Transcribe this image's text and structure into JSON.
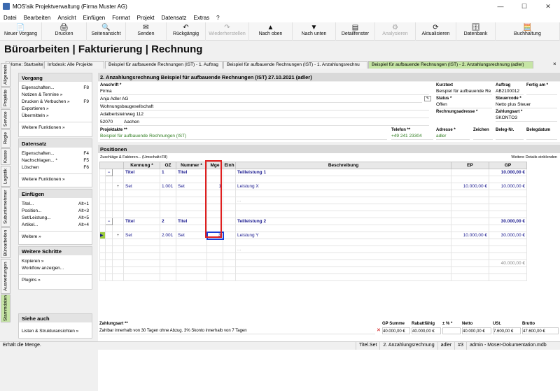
{
  "window": {
    "title": "MOS'aik Projektverwaltung (Firma Muster AG)"
  },
  "menu": [
    "Datei",
    "Bearbeiten",
    "Ansicht",
    "Einfügen",
    "Format",
    "Projekt",
    "Datensatz",
    "Extras",
    "?"
  ],
  "toolbar": [
    {
      "label": "Neuer Vorgang",
      "icon": "📄",
      "w": 60,
      "dis": false
    },
    {
      "label": "Drucken",
      "icon": "🖨",
      "w": 64,
      "dis": false
    },
    {
      "label": "Seitenansicht",
      "icon": "🔍",
      "w": 56,
      "dis": false
    },
    {
      "label": "Senden",
      "icon": "✉",
      "w": 58,
      "dis": false
    },
    {
      "label": "Rückgängig",
      "icon": "↶",
      "w": 56,
      "dis": false
    },
    {
      "label": "Wiederherstellen",
      "icon": "↷",
      "w": 62,
      "dis": true
    },
    {
      "label": "Nach oben",
      "icon": "▲",
      "w": 62,
      "dis": false
    },
    {
      "label": "Nach unten",
      "icon": "▼",
      "w": 62,
      "dis": false
    },
    {
      "label": "Detailfenster",
      "icon": "▤",
      "w": 56,
      "dis": false
    },
    {
      "label": "Analysieren",
      "icon": "⚙",
      "w": 58,
      "dis": true
    },
    {
      "label": "Aktualisieren",
      "icon": "⟳",
      "w": 58,
      "dis": false
    },
    {
      "label": "Datenbank",
      "icon": "🗄",
      "w": 56,
      "dis": false
    },
    {
      "label": "Buchhaltung",
      "icon": "🧮",
      "w": 92,
      "dis": false
    }
  ],
  "page_title": "Büroarbeiten | Fakturierung | Rechnung",
  "tabs": [
    {
      "label": "Home: Startseite",
      "w": 54,
      "active": false
    },
    {
      "label": "Infodesk: Alle Projekte",
      "w": 86,
      "active": false
    },
    {
      "label": "Beispiel für aufbauende Rechnungen (IST) - 1. Auftrag",
      "w": 168,
      "active": false
    },
    {
      "label": "Beispiel für aufbauende Rechnungen (IST) - 1. Anzahlungsrechnu",
      "w": 206,
      "active": false
    },
    {
      "label": "Beispiel für aufbauende Rechnungen (IST) - 2. Anzahlungsrechnung (adler)",
      "w": 236,
      "active": true
    }
  ],
  "tab_close": "×",
  "vertical_tabs": [
    {
      "label": "Allgemein",
      "h": 34,
      "active": false
    },
    {
      "label": "Projekte",
      "h": 30,
      "active": false
    },
    {
      "label": "Service",
      "h": 28,
      "active": false
    },
    {
      "label": "Regie",
      "h": 26,
      "active": false
    },
    {
      "label": "Kasse",
      "h": 24,
      "active": false
    },
    {
      "label": "Logistik",
      "h": 30,
      "active": false
    },
    {
      "label": "Subunternehmer",
      "h": 56,
      "active": false
    },
    {
      "label": "Büroarbeiten",
      "h": 44,
      "active": false
    },
    {
      "label": "Auswertungen",
      "h": 50,
      "active": false
    },
    {
      "label": "Stammdaten",
      "h": 40,
      "active": true
    }
  ],
  "left_panel": {
    "vorgang": {
      "title": "Vorgang",
      "items": [
        {
          "label": "Eigenschaften...",
          "key": "F8"
        },
        {
          "label": "Notizen & Termine »",
          "key": ""
        },
        {
          "label": "Drucken & Verbuchen »",
          "key": "F9"
        },
        {
          "label": "Exportieren »",
          "key": ""
        },
        {
          "label": "Übermitteln »",
          "key": ""
        }
      ],
      "more": "Weitere Funktionen »"
    },
    "datensatz": {
      "title": "Datensatz",
      "items": [
        {
          "label": "Eigenschaften...",
          "key": "F4"
        },
        {
          "label": "Nachschlagen... *",
          "key": "F5"
        },
        {
          "label": "Löschen",
          "key": "F6"
        }
      ],
      "more": "Weitere Funktionen »"
    },
    "einfuegen": {
      "title": "Einfügen",
      "items": [
        {
          "label": "Titel...",
          "key": "Alt+1"
        },
        {
          "label": "Position...",
          "key": "Alt+3"
        },
        {
          "label": "Set/Leistung...",
          "key": "Alt+5"
        },
        {
          "label": "Artikel...",
          "key": "Alt+4"
        }
      ],
      "more": "Weitere »"
    },
    "schritte": {
      "title": "Weitere Schritte",
      "items": [
        {
          "label": "Kopieren »",
          "key": ""
        },
        {
          "label": "Workflow anzeigen...",
          "key": ""
        }
      ],
      "more": "Plugins »"
    },
    "siehe": {
      "title": "Siehe auch",
      "more": "Listen & Strukturansichten »"
    }
  },
  "doc": {
    "header": "2. Anzahlungsrechnung Beispiel für aufbauende Rechnungen (IST) 27.10.2021 (adler)",
    "anschrift_label": "Anschrift *",
    "anschrift": [
      "Firma",
      "Anja Adler AG",
      "Wohnungsbaugesellschaft",
      "Adalbertsteinweg 112"
    ],
    "plz": "52070",
    "ort": "Aachen",
    "kurztext_label": "Kurztext",
    "kurztext": "Beispiel für aufbauende Re",
    "auftrag_label": "Auftrag",
    "auftrag": "AB2100012",
    "fertig_label": "Fertig am *",
    "fertig": "",
    "status_label": "Status *",
    "status": "Offen",
    "steuercode_label": "Steuercode *",
    "steuercode": "Netto plus Steuer",
    "rechnungsadresse_label": "Rechnungsadresse *",
    "zahlungsart_label": "Zahlungsart *",
    "zahlungsart": "SKONTO3",
    "projektakte_label": "Projektakte **",
    "projektakte": "Beispiel für aufbauende Rechnungen (IST)",
    "telefon_label": "Telefon **",
    "telefon": "+49 241 23304",
    "adresse_label": "Adresse *",
    "adresse": "adler",
    "zeichen_label": "Zeichen",
    "belegnr_label": "Beleg-Nr.",
    "belegdatum_label": "Belegdatum"
  },
  "positions": {
    "title": "Positionen",
    "zuschlaege": "Zuschläge & Faktoren... (Umschalt+F8)",
    "details": "Weitere Details einblenden",
    "columns": [
      "Kennung *",
      "OZ",
      "Nummer *",
      "Mge",
      "Einh",
      "Beschreibung",
      "EP",
      "GP"
    ],
    "rows": [
      {
        "type": "title",
        "kennung": "Titel",
        "oz": "1",
        "nummer": "Titel",
        "mge": "",
        "einh": "",
        "beschreibung": "Teilleistung 1",
        "ep": "",
        "gp": "10.000,00 €"
      },
      {
        "type": "blank"
      },
      {
        "type": "set",
        "kennung": "Set",
        "oz": "1.001",
        "nummer": "Set",
        "mge": "1",
        "einh": "",
        "beschreibung": "Leistung X",
        "ep": "10.000,00 €",
        "gp": "10.000,00 €"
      },
      {
        "type": "blank"
      },
      {
        "type": "dots",
        "beschreibung": "..."
      },
      {
        "type": "blank"
      },
      {
        "type": "blank"
      },
      {
        "type": "title",
        "kennung": "Titel",
        "oz": "2",
        "nummer": "Titel",
        "mge": "",
        "einh": "",
        "beschreibung": "Teilleistung 2",
        "ep": "",
        "gp": "30.000,00 €"
      },
      {
        "type": "blank"
      },
      {
        "type": "set",
        "kennung": "Set",
        "oz": "2.001",
        "nummer": "Set",
        "mge": "3",
        "einh": "",
        "beschreibung": "Leistung Y",
        "ep": "10.000,00 €",
        "gp": "30.000,00 €",
        "current": true
      },
      {
        "type": "blank"
      },
      {
        "type": "dots",
        "beschreibung": "..."
      },
      {
        "type": "blank"
      },
      {
        "type": "total",
        "gp": "40.000,00 €"
      },
      {
        "type": "blank"
      },
      {
        "type": "blank"
      }
    ]
  },
  "footer": {
    "zahlungsart_label": "Zahlungsart **",
    "zahlungsart": "Zahlbar innerhalb von 30 Tagen ohne Abzug. 3% Skonto innerhalb von 7 Tagen",
    "cols": [
      {
        "label": "GP Summe",
        "value": "40.000,00 €"
      },
      {
        "label": "Rabattfähig",
        "value": "40.000,00 €"
      },
      {
        "label": "± % *",
        "value": ""
      },
      {
        "label": "Netto",
        "value": "40.000,00 €"
      },
      {
        "label": "USt.",
        "value": "7.600,00 €"
      },
      {
        "label": "Brutto",
        "value": "47.600,00 €"
      }
    ]
  },
  "statusbar": {
    "message": "Erhält die Menge.",
    "items": [
      "Titel.Set",
      "2. Anzahlungsrechnung",
      "adler",
      "#3",
      "admin - Moser-Dokumentation.mdb"
    ]
  }
}
